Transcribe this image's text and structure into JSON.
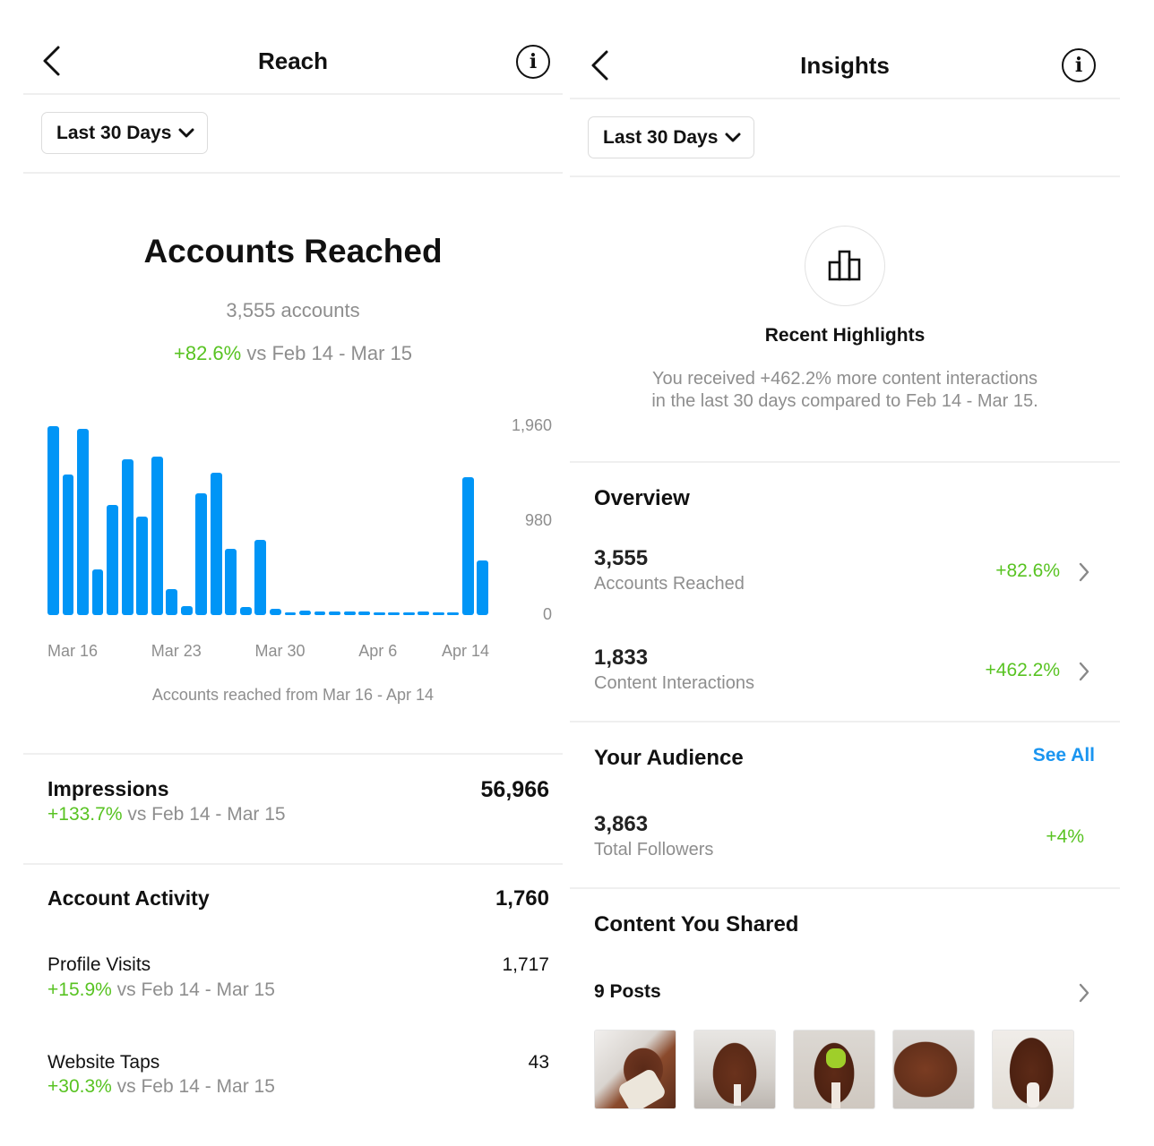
{
  "reach_screen": {
    "title": "Reach",
    "back_icon": "chevron-left-icon",
    "info_icon": "info-circle-icon",
    "date_filter": "Last 30 Days",
    "hero": {
      "title": "Accounts Reached",
      "count": "3,555 accounts",
      "change": "+82.6%",
      "comparison": " vs Feb 14 - Mar 15"
    },
    "chart_caption": "Accounts reached from Mar 16 - Apr 14",
    "impressions": {
      "label": "Impressions",
      "value": "56,966",
      "change": "+133.7%",
      "comparison": " vs Feb 14 - Mar 15"
    },
    "account_activity": {
      "label": "Account Activity",
      "value": "1,760",
      "items": [
        {
          "label": "Profile Visits",
          "value": "1,717",
          "change": "+15.9%",
          "comparison": " vs Feb 14 - Mar 15"
        },
        {
          "label": "Website Taps",
          "value": "43",
          "change": "+30.3%",
          "comparison": " vs Feb 14 - Mar 15"
        }
      ]
    }
  },
  "insights_screen": {
    "title": "Insights",
    "back_icon": "chevron-left-icon",
    "info_icon": "info-circle-icon",
    "date_filter": "Last 30 Days",
    "highlights": {
      "icon": "bar-chart-icon",
      "title": "Recent Highlights",
      "line1": "You received +462.2% more content interactions",
      "line2": "in the last 30 days compared to Feb 14 - Mar 15."
    },
    "overview": {
      "title": "Overview",
      "rows": [
        {
          "value": "3,555",
          "label": "Accounts Reached",
          "change": "+82.6%"
        },
        {
          "value": "1,833",
          "label": "Content Interactions",
          "change": "+462.2%"
        }
      ]
    },
    "audience": {
      "title": "Your Audience",
      "see_all": "See All",
      "value": "3,863",
      "label": "Total Followers",
      "change": "+4%"
    },
    "content": {
      "title": "Content You Shared",
      "posts_label": "9 Posts",
      "thumbnails": [
        "dog-photo-1",
        "dog-photo-2",
        "dog-photo-3",
        "dog-photo-4",
        "dog-photo-5"
      ]
    }
  },
  "colors": {
    "accent_blue": "#0095f6",
    "link_blue": "#1a95f0",
    "positive_green": "#58c322",
    "secondary_grey": "#8e8e8e"
  },
  "chart_data": {
    "type": "bar",
    "title": "Accounts reached from Mar 16 - Apr 14",
    "xlabel": "",
    "ylabel": "",
    "ylim": [
      0,
      1960
    ],
    "y_ticks": [
      "1,960",
      "980",
      "0"
    ],
    "y_tick_values": [
      1960,
      980,
      0
    ],
    "x_tick_labels": [
      "Mar 16",
      "Mar 23",
      "Mar 30",
      "Apr 6",
      "Apr 14"
    ],
    "x_tick_indices": [
      0,
      7,
      14,
      21,
      29
    ],
    "categories": [
      "Mar 16",
      "Mar 17",
      "Mar 18",
      "Mar 19",
      "Mar 20",
      "Mar 21",
      "Mar 22",
      "Mar 23",
      "Mar 24",
      "Mar 25",
      "Mar 26",
      "Mar 27",
      "Mar 28",
      "Mar 29",
      "Mar 30",
      "Mar 31",
      "Apr 1",
      "Apr 2",
      "Apr 3",
      "Apr 4",
      "Apr 5",
      "Apr 6",
      "Apr 7",
      "Apr 8",
      "Apr 9",
      "Apr 10",
      "Apr 11",
      "Apr 12",
      "Apr 13",
      "Apr 14"
    ],
    "values": [
      1960,
      1462,
      1936,
      476,
      1145,
      1618,
      1021,
      1643,
      271,
      93,
      1264,
      1478,
      685,
      84,
      784,
      69,
      22,
      44,
      35,
      35,
      35,
      35,
      22,
      22,
      16,
      41,
      16,
      9,
      1432,
      569
    ],
    "grid": false,
    "y_axis_position": "right"
  }
}
